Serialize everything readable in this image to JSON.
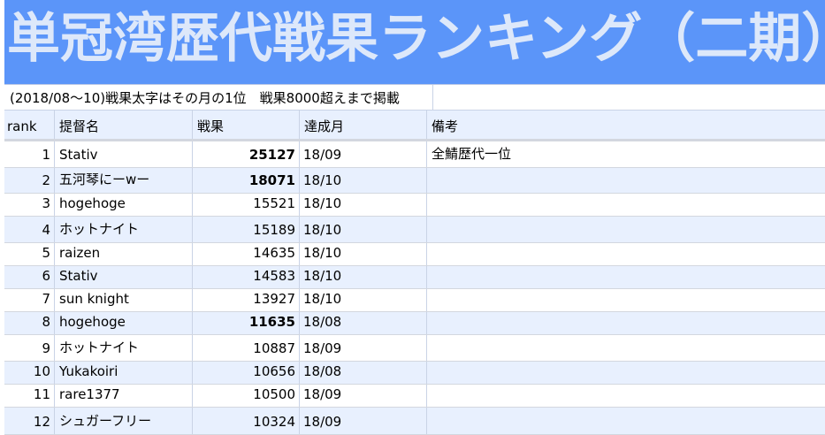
{
  "title": "単冠湾歴代戦果ランキング（二期）",
  "note": "(2018/08～10)戦果太字はその月の1位　戦果8000超えまで掲載",
  "headers": {
    "rank": "rank",
    "name": "提督名",
    "score": "戦果",
    "month": "達成月",
    "note": "備考"
  },
  "rows": [
    {
      "rank": "1",
      "name": "Stativ",
      "score": "25127",
      "bold": true,
      "month": "18/09",
      "note": "全鯖歴代一位"
    },
    {
      "rank": "2",
      "name": "五河琴にーwー",
      "score": "18071",
      "bold": true,
      "month": "18/10",
      "note": ""
    },
    {
      "rank": "3",
      "name": "hogehoge",
      "score": "15521",
      "bold": false,
      "month": "18/10",
      "note": ""
    },
    {
      "rank": "4",
      "name": "ホットナイト",
      "score": "15189",
      "bold": false,
      "month": "18/10",
      "note": ""
    },
    {
      "rank": "5",
      "name": "raizen",
      "score": "14635",
      "bold": false,
      "month": "18/10",
      "note": ""
    },
    {
      "rank": "6",
      "name": "Stativ",
      "score": "14583",
      "bold": false,
      "month": "18/10",
      "note": ""
    },
    {
      "rank": "7",
      "name": "sun knight",
      "score": "13927",
      "bold": false,
      "month": "18/10",
      "note": ""
    },
    {
      "rank": "8",
      "name": "hogehoge",
      "score": "11635",
      "bold": true,
      "month": "18/08",
      "note": ""
    },
    {
      "rank": "9",
      "name": "ホットナイト",
      "score": "10887",
      "bold": false,
      "month": "18/09",
      "note": ""
    },
    {
      "rank": "10",
      "name": "Yukakoiri",
      "score": "10656",
      "bold": false,
      "month": "18/08",
      "note": ""
    },
    {
      "rank": "11",
      "name": "rare1377",
      "score": "10500",
      "bold": false,
      "month": "18/09",
      "note": ""
    },
    {
      "rank": "12",
      "name": "シュガーフリー",
      "score": "10324",
      "bold": false,
      "month": "18/09",
      "note": ""
    }
  ]
}
